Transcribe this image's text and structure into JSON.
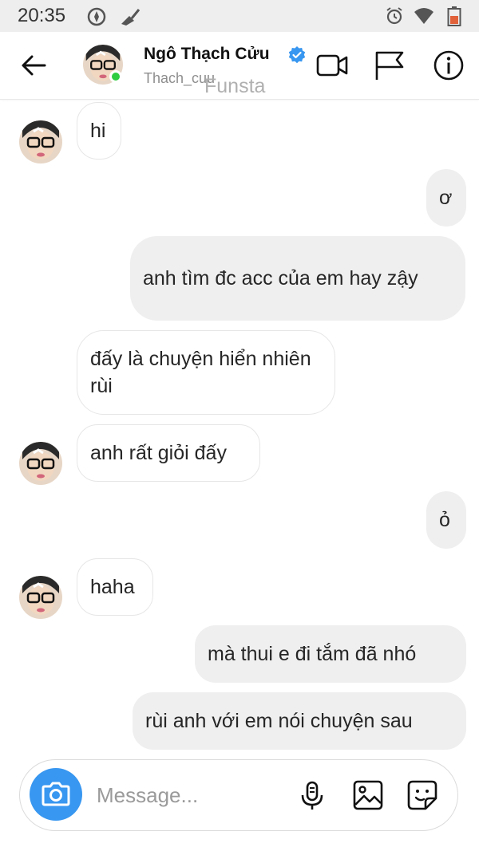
{
  "status_bar": {
    "time": "20:35"
  },
  "header": {
    "name": "Ngô Thạch Cửu",
    "username": "Thach_cuu",
    "watermark": "Funsta"
  },
  "messages": [
    {
      "side": "incoming",
      "text": "hi"
    },
    {
      "side": "outgoing",
      "text": "ơ"
    },
    {
      "side": "outgoing",
      "text": "anh tìm đc acc của em hay zậy"
    },
    {
      "side": "incoming",
      "text": "đấy là chuyện hiển nhiên rùi"
    },
    {
      "side": "incoming",
      "text": "anh rất giỏi đấy"
    },
    {
      "side": "outgoing",
      "text": "ỏ"
    },
    {
      "side": "incoming",
      "text": "haha"
    },
    {
      "side": "outgoing",
      "text": "mà thui e đi tắm đã nhó"
    },
    {
      "side": "outgoing",
      "text": "rùi anh với em nói chuyện sau"
    }
  ],
  "composer": {
    "placeholder": "Message..."
  },
  "colors": {
    "accent": "#3897f0",
    "online": "#2ecc40",
    "verified": "#3897f0",
    "outgoing_bubble": "#efefef"
  }
}
